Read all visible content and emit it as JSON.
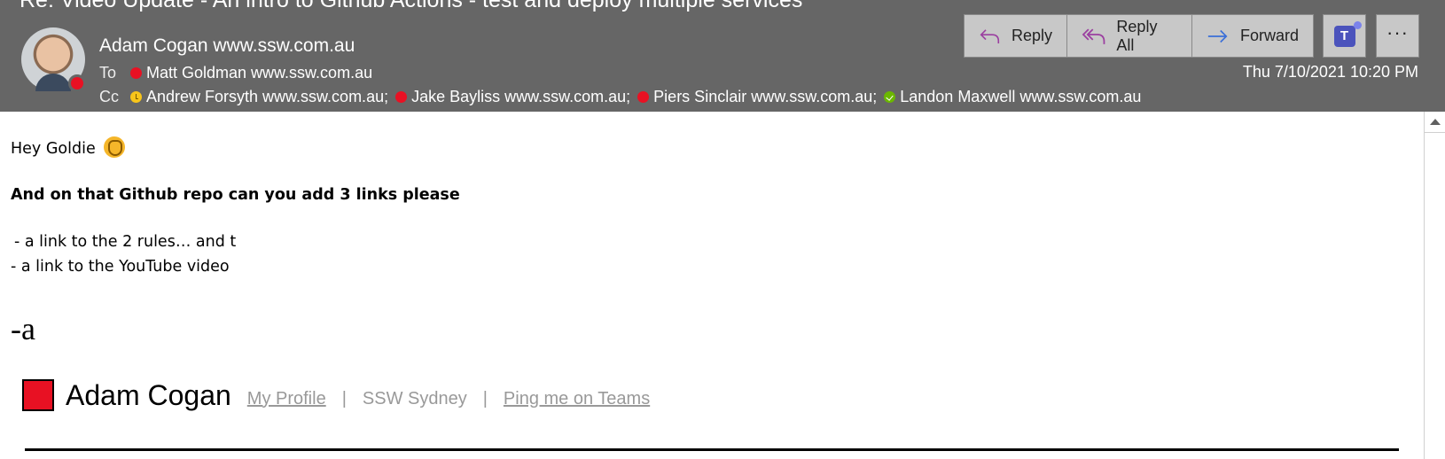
{
  "email": {
    "subject": "Re: Video Update - An intro to Github Actions - test and deploy multiple services",
    "sender": "Adam Cogan www.ssw.com.au",
    "date": "Thu 7/10/2021 10:20 PM",
    "to_label": "To",
    "cc_label": "Cc",
    "to": [
      {
        "name": "Matt Goldman www.ssw.com.au",
        "status": "busy"
      }
    ],
    "cc": [
      {
        "name": "Andrew Forsyth www.ssw.com.au;",
        "status": "away"
      },
      {
        "name": "Jake Bayliss www.ssw.com.au;",
        "status": "busy"
      },
      {
        "name": "Piers Sinclair www.ssw.com.au;",
        "status": "busy"
      },
      {
        "name": "Landon Maxwell www.ssw.com.au",
        "status": "available"
      }
    ]
  },
  "toolbar": {
    "reply_label": "Reply",
    "reply_all_label": "Reply All",
    "forward_label": "Forward",
    "teams_icon_letter": "T",
    "more_label": "···"
  },
  "body": {
    "greeting": "Hey Goldie",
    "request": "And on that Github repo can you add 3 links please",
    "item1": " - a link to the 2 rules… and t",
    "item2": "- a link to the YouTube video",
    "dash_a": "-a"
  },
  "signature": {
    "name": "Adam Cogan",
    "profile_link": "My Profile",
    "location": "SSW Sydney",
    "teams_link": "Ping me on Teams",
    "separator": "|"
  },
  "colors": {
    "header_bg": "#666666",
    "busy": "#e81123",
    "away": "#f8c51a",
    "available": "#6bb700",
    "button_bg": "#c8c8c8",
    "reply_icon": "#9b3fa0",
    "forward_icon": "#3a6fd8"
  }
}
